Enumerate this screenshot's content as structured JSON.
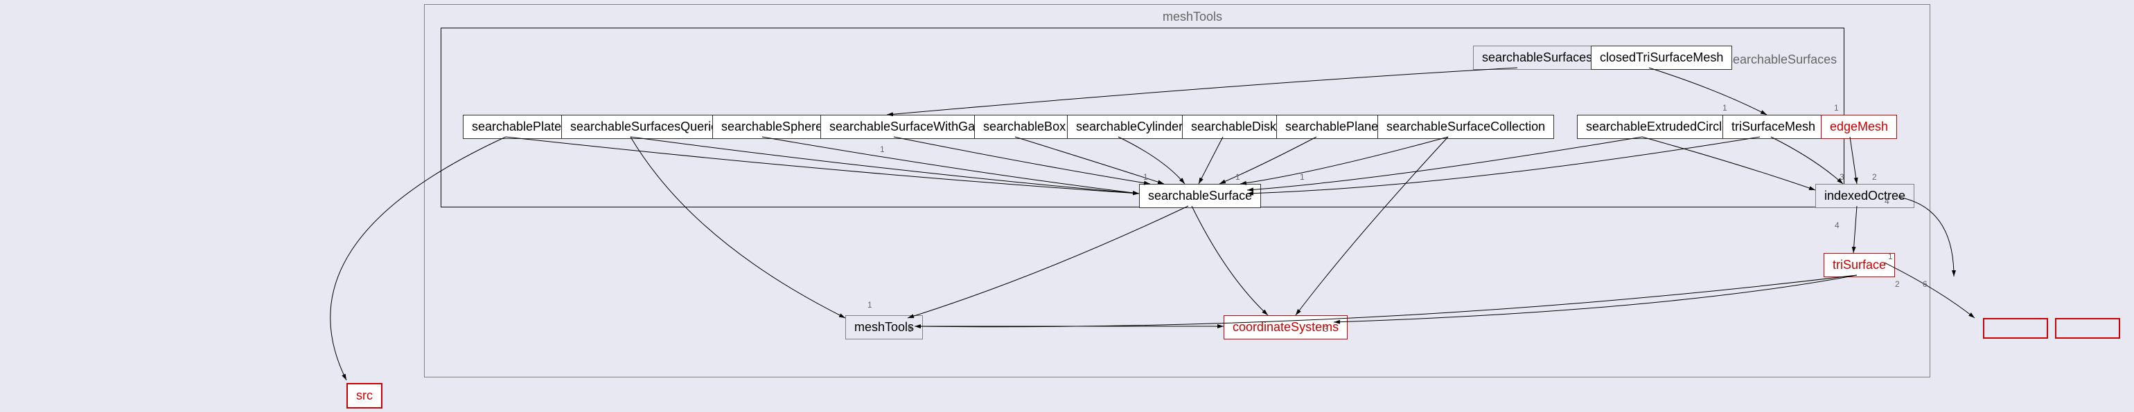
{
  "labels": {
    "meshTools_title": "meshTools",
    "searchableSurfaces_title": "searchableSurfaces"
  },
  "nodes": {
    "searchableSurfaces_box": "searchableSurfaces",
    "closedTriSurfaceMesh": "closedTriSurfaceMesh",
    "searchablePlate": "searchablePlate",
    "searchableSurfacesQueries": "searchableSurfacesQueries",
    "searchableSphere": "searchableSphere",
    "searchableSurfaceWithGaps": "searchableSurfaceWithGaps",
    "searchableBox": "searchableBox",
    "searchableCylinder": "searchableCylinder",
    "searchableDisk": "searchableDisk",
    "searchablePlane": "searchablePlane",
    "searchableSurfaceCollection": "searchableSurfaceCollection",
    "searchableExtrudedCircle": "searchableExtrudedCircle",
    "triSurfaceMesh": "triSurfaceMesh",
    "edgeMesh": "edgeMesh",
    "searchableSurface": "searchableSurface",
    "indexedOctree": "indexedOctree",
    "triSurface": "triSurface",
    "meshTools_node": "meshTools",
    "coordinateSystems": "coordinateSystems",
    "bottom_left": "src"
  }
}
